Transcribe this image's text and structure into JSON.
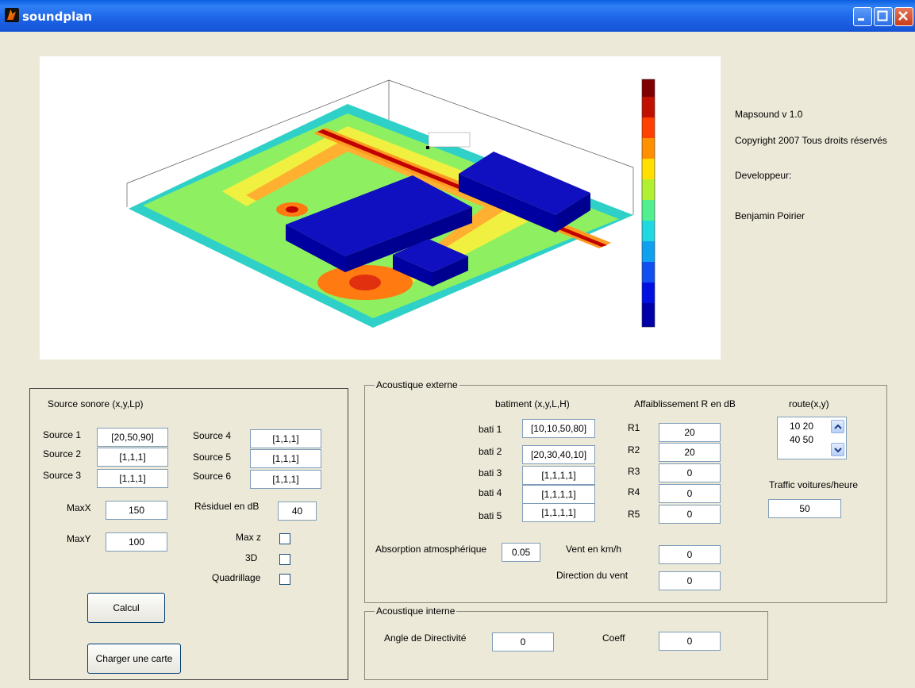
{
  "window": {
    "title": "soundplan"
  },
  "info": {
    "version": "Mapsound v 1.0",
    "copyright": "Copyright 2007 Tous droits réservés",
    "developer_label": "Developpeur:",
    "developer_name": "Benjamin Poirier"
  },
  "source_panel": {
    "title": "Source sonore  (x,y,Lp)",
    "sources": [
      {
        "label": "Source 1",
        "value": "[20,50,90]"
      },
      {
        "label": "Source 2",
        "value": "[1,1,1]"
      },
      {
        "label": "Source 3",
        "value": "[1,1,1]"
      },
      {
        "label": "Source 4",
        "value": "[1,1,1]"
      },
      {
        "label": "Source 5",
        "value": "[1,1,1]"
      },
      {
        "label": "Source 6",
        "value": "[1,1,1]"
      }
    ],
    "maxx_label": "MaxX",
    "maxx_value": "150",
    "maxy_label": "MaxY",
    "maxy_value": "100",
    "residuel_label": "Résiduel en dB",
    "residuel_value": "40",
    "maxz_label": "Max z",
    "three_d_label": "3D",
    "quadrillage_label": "Quadrillage",
    "calcul_button": "Calcul",
    "charger_button": "Charger une carte"
  },
  "externe": {
    "legend": "Acoustique externe",
    "batiment_header": "batiment (x,y,L,H)",
    "affaiblissement_header": "Affaiblissement R en dB",
    "route_header": "route(x,y)",
    "batis": [
      {
        "label": "bati 1",
        "value": "[10,10,50,80]"
      },
      {
        "label": "bati 2",
        "value": "[20,30,40,10]"
      },
      {
        "label": "bati 3",
        "value": "[1,1,1,1]"
      },
      {
        "label": "bati 4",
        "value": "[1,1,1,1]"
      },
      {
        "label": "bati 5",
        "value": "[1,1,1,1]"
      }
    ],
    "r": [
      {
        "label": "R1",
        "value": "20"
      },
      {
        "label": "R2",
        "value": "20"
      },
      {
        "label": "R3",
        "value": "0"
      },
      {
        "label": "R4",
        "value": "0"
      },
      {
        "label": "R5",
        "value": "0"
      }
    ],
    "route_items": [
      "10 20",
      "40 50"
    ],
    "traffic_label": "Traffic voitures/heure",
    "traffic_value": "50",
    "absorption_label": "Absorption atmosphérique",
    "absorption_value": "0.05",
    "vent_label": "Vent en km/h",
    "vent_value": "0",
    "direction_label": "Direction du vent",
    "direction_value": "0"
  },
  "interne": {
    "legend": "Acoustique interne",
    "angle_label": "Angle de Directivité",
    "angle_value": "0",
    "coeff_label": "Coeff",
    "coeff_value": "0"
  }
}
